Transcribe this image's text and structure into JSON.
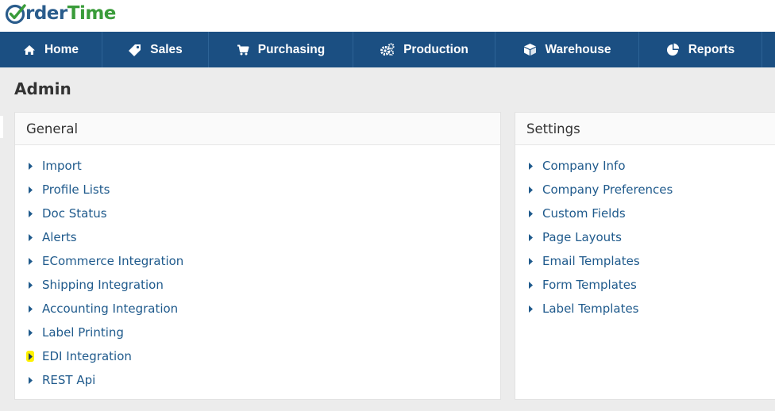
{
  "logo": {
    "part1": "rder",
    "part2": "Time",
    "accent": "#3a9c3a",
    "brand": "#2a5c8c"
  },
  "nav": [
    {
      "label": "Home",
      "icon": "home-icon"
    },
    {
      "label": "Sales",
      "icon": "tag-icon"
    },
    {
      "label": "Purchasing",
      "icon": "cart-icon"
    },
    {
      "label": "Production",
      "icon": "gears-icon"
    },
    {
      "label": "Warehouse",
      "icon": "cube-icon"
    },
    {
      "label": "Reports",
      "icon": "pie-chart-icon"
    }
  ],
  "page": {
    "title": "Admin"
  },
  "general": {
    "title": "General",
    "items": [
      {
        "label": "Import"
      },
      {
        "label": "Profile Lists"
      },
      {
        "label": "Doc Status"
      },
      {
        "label": "Alerts"
      },
      {
        "label": "ECommerce Integration"
      },
      {
        "label": "Shipping Integration"
      },
      {
        "label": "Accounting Integration"
      },
      {
        "label": "Label Printing"
      },
      {
        "label": "EDI Integration",
        "highlighted": true
      },
      {
        "label": "REST Api"
      }
    ]
  },
  "settings": {
    "title": "Settings",
    "items": [
      {
        "label": "Company Info"
      },
      {
        "label": "Company Preferences"
      },
      {
        "label": "Custom Fields"
      },
      {
        "label": "Page Layouts"
      },
      {
        "label": "Email Templates"
      },
      {
        "label": "Form Templates"
      },
      {
        "label": "Label Templates"
      }
    ]
  },
  "colors": {
    "navbar": "#1b4f82",
    "link": "#1f5a8c",
    "highlight": "#fff200"
  }
}
